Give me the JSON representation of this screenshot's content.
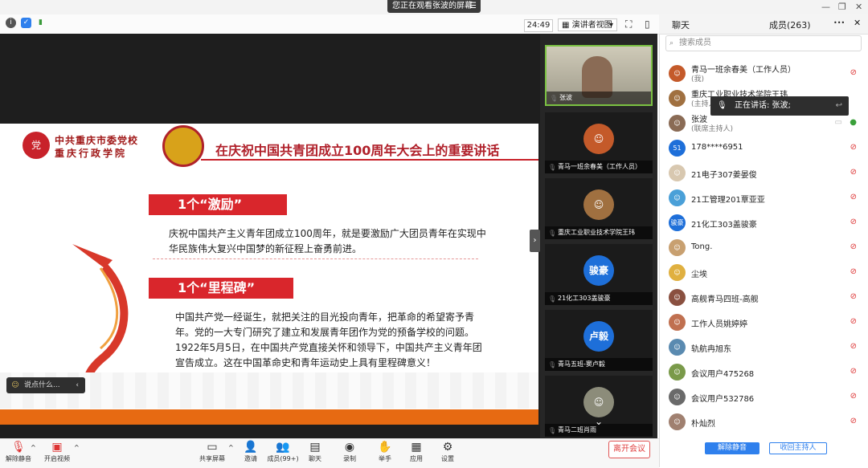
{
  "titlebar": {
    "sharing_notice": "您正在观看张波的屏幕",
    "menu_glyph": "☰",
    "win_minimize": "—",
    "win_restore": "❐",
    "win_close": "✕"
  },
  "toolbar": {
    "timer": "24:49",
    "view_mode": "演讲者视图",
    "view_chevron": "▾",
    "fullscreen_glyph": "⛶",
    "layout_glyph": "▯"
  },
  "slide": {
    "school_line1": "中共重庆市委党校",
    "school_line2": "重庆行政学院",
    "title": "在庆祝中国共青团成立100周年大会上的重要讲话",
    "section1": "1个“激励”",
    "section1_text": "庆祝中国共产主义青年团成立100周年，就是要激励广大团员青年在实现中华民族伟大复兴中国梦的新征程上奋勇前进。",
    "section2": "1个“里程碑”",
    "section2_text": "中国共产党一经诞生，就把关注的目光投向青年，把革命的希望寄予青年。党的一大专门研究了建立和发展青年团作为党的预备学校的问题。1922年5月5日，在中国共产党直接关怀和领导下，中国共产主义青年团宣告成立。这在中国革命史和青年运动史上具有里程碑意义！"
  },
  "stage": {
    "chat_placeholder": "说点什么...",
    "chat_arrow": "‹",
    "collapse_glyph": "›"
  },
  "video_tiles": [
    {
      "name": "张波",
      "avatar": "",
      "color": ""
    },
    {
      "name": "青马一班余春美（工作人员）",
      "avatar": "",
      "color": "#c45a2a"
    },
    {
      "name": "重庆工业职业技术学院王玮",
      "avatar": "",
      "color": "#a07040"
    },
    {
      "name": "21化工303盖骏豪",
      "avatar": "骏豪",
      "color": "#1e6fd9"
    },
    {
      "name": "青马五班-窦卢毅",
      "avatar": "卢毅",
      "color": "#1e6fd9"
    },
    {
      "name": "青马二班肖雨",
      "avatar": "",
      "color": "#8c8c7a"
    }
  ],
  "video_scroll_glyph": "⌄",
  "panel": {
    "tab_chat": "聊天",
    "tab_members": "成员(263)",
    "tab_more": "•••",
    "tab_close": "✕",
    "search_placeholder": "搜索成员",
    "speaking_now": "正在讲话: 张波;",
    "unmute_all": "解除静音",
    "reclaim_host": "收回主持人"
  },
  "members": [
    {
      "name": "青马一班余春美（工作人员）",
      "sub": "(我)",
      "avatar": "",
      "color": "#c45a2a"
    },
    {
      "name": "重庆工业职业技术学院王玮",
      "sub": "(主持人)",
      "avatar": "",
      "color": "#a07040"
    },
    {
      "name": "张波",
      "sub": "(联席主持人)",
      "avatar": "",
      "color": "#8a6b55"
    },
    {
      "name": "178****6951",
      "sub": "",
      "avatar": "51",
      "color": "#1e6fd9"
    },
    {
      "name": "21电子307姜晏俊",
      "sub": "",
      "avatar": "",
      "color": "#d8c8b0"
    },
    {
      "name": "21工管理201覃亚亚",
      "sub": "",
      "avatar": "",
      "color": "#4aa0d8"
    },
    {
      "name": "21化工303盖骏豪",
      "sub": "",
      "avatar": "骏豪",
      "color": "#1e6fd9"
    },
    {
      "name": "Tong.",
      "sub": "",
      "avatar": "",
      "color": "#c8a070"
    },
    {
      "name": "尘埃",
      "sub": "",
      "avatar": "",
      "color": "#e0b040"
    },
    {
      "name": "高舰青马四班-高舰",
      "sub": "",
      "avatar": "",
      "color": "#8a5040"
    },
    {
      "name": "工作人员姚婷婷",
      "sub": "",
      "avatar": "",
      "color": "#c07050"
    },
    {
      "name": "轨航冉旭东",
      "sub": "",
      "avatar": "",
      "color": "#5a8ab0"
    },
    {
      "name": "会议用户475268",
      "sub": "",
      "avatar": "",
      "color": "#7a9a4a"
    },
    {
      "name": "会议用户532786",
      "sub": "",
      "avatar": "",
      "color": "#6a6a6a"
    },
    {
      "name": "朴灿烈",
      "sub": "",
      "avatar": "",
      "color": "#a08070"
    }
  ],
  "member_muted_glyph": "⊘",
  "bottom": {
    "unmute": "解除静音",
    "start_video": "开启视频",
    "share_screen": "共享屏幕",
    "invite": "邀请",
    "members": "成员(99+)",
    "chat": "聊天",
    "record": "录制",
    "raise_hand": "举手",
    "apps": "应用",
    "settings": "设置",
    "leave": "离开会议",
    "caret": "^"
  }
}
